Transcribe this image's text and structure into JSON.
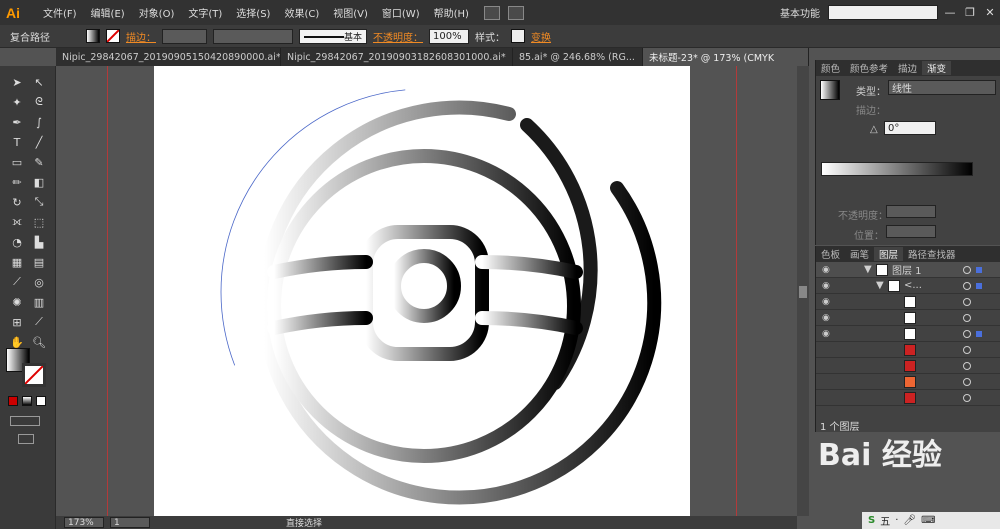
{
  "app": {
    "logo": "Ai",
    "workspace": "基本功能"
  },
  "menu": [
    "文件(F)",
    "编辑(E)",
    "对象(O)",
    "文字(T)",
    "选择(S)",
    "效果(C)",
    "视图(V)",
    "窗口(W)",
    "帮助(H)"
  ],
  "window_buttons": [
    "—",
    "❐",
    "✕"
  ],
  "control": {
    "object_type": "复合路径",
    "stroke_label": "描边：",
    "stroke_style": "基本",
    "opacity_label": "不透明度：",
    "opacity_value": "100%",
    "style_label": "样式：",
    "transform_label": "变换"
  },
  "tabs": [
    "Nipic_29842067_20190905150420890000.ai*",
    "Nipic_29842067_20190903182608301000.ai*",
    "85.ai* @ 246.68% (RG...",
    "未标题-23* @ 173% (CMYK"
  ],
  "status": {
    "zoom": "173%",
    "page": "1",
    "tool": "直接选择"
  },
  "gradient_panel": {
    "tabs": [
      "颜色",
      "颜色参考",
      "描边",
      "渐变"
    ],
    "type_label": "类型：",
    "type_value": "线性",
    "stroke_label": "描边：",
    "angle_value": "0°",
    "opacity_label": "不透明度：",
    "location_label": "位置："
  },
  "layers_panel": {
    "tabs": [
      "色板",
      "画笔",
      "图层",
      "路径查找器"
    ],
    "layer_name": "图层 1",
    "sublayer_name": "<...",
    "footer": "1 个图层"
  },
  "watermark": "Bai 经验",
  "tray": [
    "S",
    "五",
    "·"
  ],
  "colors": {
    "artboard": "#ffffff",
    "accent": "#f08a24",
    "guide": "#b23a3a",
    "ui_dark": "#323232"
  }
}
